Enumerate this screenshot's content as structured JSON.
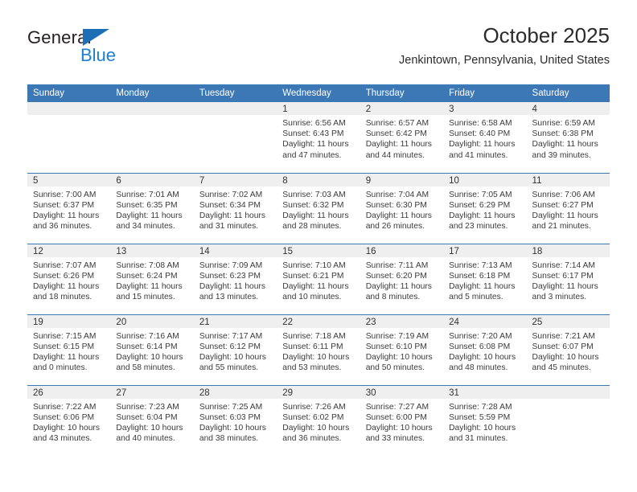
{
  "brand": {
    "name_top": "General",
    "name_bottom": "Blue",
    "accent_color": "#1c7fd4",
    "triangle_color": "#1c6fb5"
  },
  "header": {
    "title": "October 2025",
    "location": "Jenkintown, Pennsylvania, United States"
  },
  "calendar": {
    "header_bg": "#3c78b5",
    "header_text_color": "#ffffff",
    "daynum_band_bg": "#efefef",
    "weekday_headers": [
      "Sunday",
      "Monday",
      "Tuesday",
      "Wednesday",
      "Thursday",
      "Friday",
      "Saturday"
    ],
    "weeks": [
      [
        {
          "day": "",
          "sunrise": "",
          "sunset": "",
          "daylight_line1": "",
          "daylight_line2": ""
        },
        {
          "day": "",
          "sunrise": "",
          "sunset": "",
          "daylight_line1": "",
          "daylight_line2": ""
        },
        {
          "day": "",
          "sunrise": "",
          "sunset": "",
          "daylight_line1": "",
          "daylight_line2": ""
        },
        {
          "day": "1",
          "sunrise": "Sunrise: 6:56 AM",
          "sunset": "Sunset: 6:43 PM",
          "daylight_line1": "Daylight: 11 hours",
          "daylight_line2": "and 47 minutes."
        },
        {
          "day": "2",
          "sunrise": "Sunrise: 6:57 AM",
          "sunset": "Sunset: 6:42 PM",
          "daylight_line1": "Daylight: 11 hours",
          "daylight_line2": "and 44 minutes."
        },
        {
          "day": "3",
          "sunrise": "Sunrise: 6:58 AM",
          "sunset": "Sunset: 6:40 PM",
          "daylight_line1": "Daylight: 11 hours",
          "daylight_line2": "and 41 minutes."
        },
        {
          "day": "4",
          "sunrise": "Sunrise: 6:59 AM",
          "sunset": "Sunset: 6:38 PM",
          "daylight_line1": "Daylight: 11 hours",
          "daylight_line2": "and 39 minutes."
        }
      ],
      [
        {
          "day": "5",
          "sunrise": "Sunrise: 7:00 AM",
          "sunset": "Sunset: 6:37 PM",
          "daylight_line1": "Daylight: 11 hours",
          "daylight_line2": "and 36 minutes."
        },
        {
          "day": "6",
          "sunrise": "Sunrise: 7:01 AM",
          "sunset": "Sunset: 6:35 PM",
          "daylight_line1": "Daylight: 11 hours",
          "daylight_line2": "and 34 minutes."
        },
        {
          "day": "7",
          "sunrise": "Sunrise: 7:02 AM",
          "sunset": "Sunset: 6:34 PM",
          "daylight_line1": "Daylight: 11 hours",
          "daylight_line2": "and 31 minutes."
        },
        {
          "day": "8",
          "sunrise": "Sunrise: 7:03 AM",
          "sunset": "Sunset: 6:32 PM",
          "daylight_line1": "Daylight: 11 hours",
          "daylight_line2": "and 28 minutes."
        },
        {
          "day": "9",
          "sunrise": "Sunrise: 7:04 AM",
          "sunset": "Sunset: 6:30 PM",
          "daylight_line1": "Daylight: 11 hours",
          "daylight_line2": "and 26 minutes."
        },
        {
          "day": "10",
          "sunrise": "Sunrise: 7:05 AM",
          "sunset": "Sunset: 6:29 PM",
          "daylight_line1": "Daylight: 11 hours",
          "daylight_line2": "and 23 minutes."
        },
        {
          "day": "11",
          "sunrise": "Sunrise: 7:06 AM",
          "sunset": "Sunset: 6:27 PM",
          "daylight_line1": "Daylight: 11 hours",
          "daylight_line2": "and 21 minutes."
        }
      ],
      [
        {
          "day": "12",
          "sunrise": "Sunrise: 7:07 AM",
          "sunset": "Sunset: 6:26 PM",
          "daylight_line1": "Daylight: 11 hours",
          "daylight_line2": "and 18 minutes."
        },
        {
          "day": "13",
          "sunrise": "Sunrise: 7:08 AM",
          "sunset": "Sunset: 6:24 PM",
          "daylight_line1": "Daylight: 11 hours",
          "daylight_line2": "and 15 minutes."
        },
        {
          "day": "14",
          "sunrise": "Sunrise: 7:09 AM",
          "sunset": "Sunset: 6:23 PM",
          "daylight_line1": "Daylight: 11 hours",
          "daylight_line2": "and 13 minutes."
        },
        {
          "day": "15",
          "sunrise": "Sunrise: 7:10 AM",
          "sunset": "Sunset: 6:21 PM",
          "daylight_line1": "Daylight: 11 hours",
          "daylight_line2": "and 10 minutes."
        },
        {
          "day": "16",
          "sunrise": "Sunrise: 7:11 AM",
          "sunset": "Sunset: 6:20 PM",
          "daylight_line1": "Daylight: 11 hours",
          "daylight_line2": "and 8 minutes."
        },
        {
          "day": "17",
          "sunrise": "Sunrise: 7:13 AM",
          "sunset": "Sunset: 6:18 PM",
          "daylight_line1": "Daylight: 11 hours",
          "daylight_line2": "and 5 minutes."
        },
        {
          "day": "18",
          "sunrise": "Sunrise: 7:14 AM",
          "sunset": "Sunset: 6:17 PM",
          "daylight_line1": "Daylight: 11 hours",
          "daylight_line2": "and 3 minutes."
        }
      ],
      [
        {
          "day": "19",
          "sunrise": "Sunrise: 7:15 AM",
          "sunset": "Sunset: 6:15 PM",
          "daylight_line1": "Daylight: 11 hours",
          "daylight_line2": "and 0 minutes."
        },
        {
          "day": "20",
          "sunrise": "Sunrise: 7:16 AM",
          "sunset": "Sunset: 6:14 PM",
          "daylight_line1": "Daylight: 10 hours",
          "daylight_line2": "and 58 minutes."
        },
        {
          "day": "21",
          "sunrise": "Sunrise: 7:17 AM",
          "sunset": "Sunset: 6:12 PM",
          "daylight_line1": "Daylight: 10 hours",
          "daylight_line2": "and 55 minutes."
        },
        {
          "day": "22",
          "sunrise": "Sunrise: 7:18 AM",
          "sunset": "Sunset: 6:11 PM",
          "daylight_line1": "Daylight: 10 hours",
          "daylight_line2": "and 53 minutes."
        },
        {
          "day": "23",
          "sunrise": "Sunrise: 7:19 AM",
          "sunset": "Sunset: 6:10 PM",
          "daylight_line1": "Daylight: 10 hours",
          "daylight_line2": "and 50 minutes."
        },
        {
          "day": "24",
          "sunrise": "Sunrise: 7:20 AM",
          "sunset": "Sunset: 6:08 PM",
          "daylight_line1": "Daylight: 10 hours",
          "daylight_line2": "and 48 minutes."
        },
        {
          "day": "25",
          "sunrise": "Sunrise: 7:21 AM",
          "sunset": "Sunset: 6:07 PM",
          "daylight_line1": "Daylight: 10 hours",
          "daylight_line2": "and 45 minutes."
        }
      ],
      [
        {
          "day": "26",
          "sunrise": "Sunrise: 7:22 AM",
          "sunset": "Sunset: 6:06 PM",
          "daylight_line1": "Daylight: 10 hours",
          "daylight_line2": "and 43 minutes."
        },
        {
          "day": "27",
          "sunrise": "Sunrise: 7:23 AM",
          "sunset": "Sunset: 6:04 PM",
          "daylight_line1": "Daylight: 10 hours",
          "daylight_line2": "and 40 minutes."
        },
        {
          "day": "28",
          "sunrise": "Sunrise: 7:25 AM",
          "sunset": "Sunset: 6:03 PM",
          "daylight_line1": "Daylight: 10 hours",
          "daylight_line2": "and 38 minutes."
        },
        {
          "day": "29",
          "sunrise": "Sunrise: 7:26 AM",
          "sunset": "Sunset: 6:02 PM",
          "daylight_line1": "Daylight: 10 hours",
          "daylight_line2": "and 36 minutes."
        },
        {
          "day": "30",
          "sunrise": "Sunrise: 7:27 AM",
          "sunset": "Sunset: 6:00 PM",
          "daylight_line1": "Daylight: 10 hours",
          "daylight_line2": "and 33 minutes."
        },
        {
          "day": "31",
          "sunrise": "Sunrise: 7:28 AM",
          "sunset": "Sunset: 5:59 PM",
          "daylight_line1": "Daylight: 10 hours",
          "daylight_line2": "and 31 minutes."
        },
        {
          "day": "",
          "sunrise": "",
          "sunset": "",
          "daylight_line1": "",
          "daylight_line2": ""
        }
      ]
    ]
  }
}
